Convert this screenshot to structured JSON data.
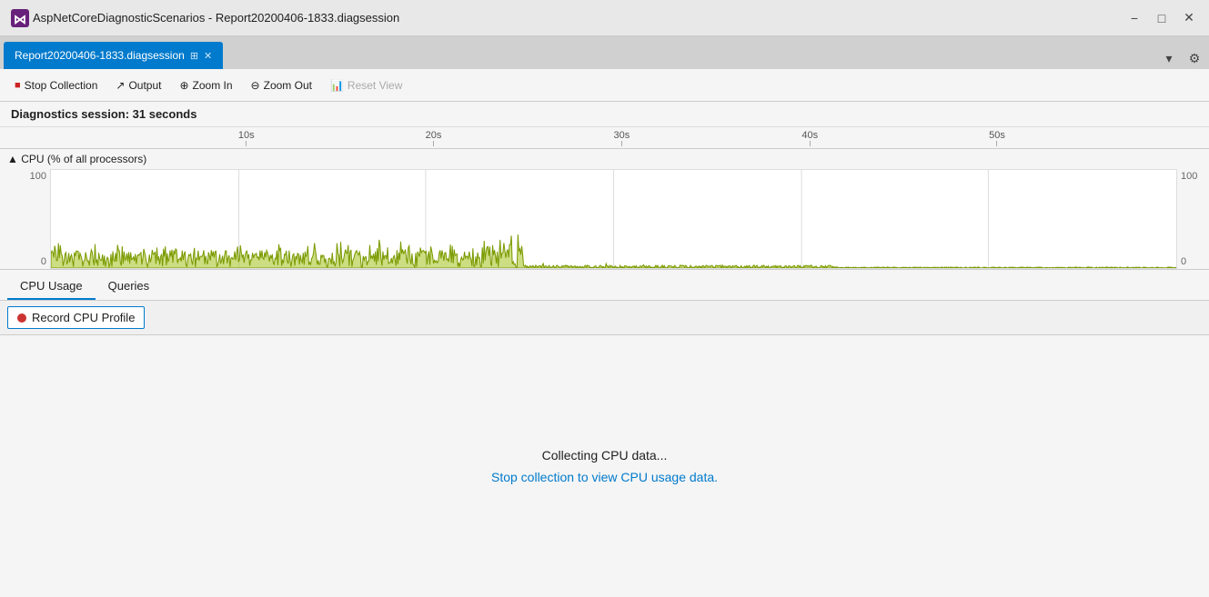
{
  "titleBar": {
    "title": "AspNetCoreDiagnosticScenarios - Report20200406-1833.diagsession",
    "minBtn": "−",
    "maxBtn": "□",
    "closeBtn": "✕"
  },
  "tab": {
    "label": "Report20200406-1833.diagsession",
    "pin": "⊞",
    "close": "✕"
  },
  "toolbar": {
    "stopCollection": "Stop Collection",
    "output": "Output",
    "zoomIn": "Zoom In",
    "zoomOut": "Zoom Out",
    "resetView": "Reset View"
  },
  "diagHeader": {
    "text": "Diagnostics session: 31 seconds"
  },
  "timeRuler": {
    "ticks": [
      {
        "label": "10s",
        "percent": 16.7
      },
      {
        "label": "20s",
        "percent": 33.3
      },
      {
        "label": "30s",
        "percent": 50.0
      },
      {
        "label": "40s",
        "percent": 66.7
      },
      {
        "label": "50s",
        "percent": 83.3
      }
    ]
  },
  "chart": {
    "title": "▲ CPU (% of all processors)",
    "yMax": "100",
    "yMin": "0",
    "yMaxRight": "100",
    "yMinRight": "0"
  },
  "panelTabs": [
    {
      "label": "CPU Usage",
      "active": true
    },
    {
      "label": "Queries",
      "active": false
    }
  ],
  "recordBtn": {
    "label": "Record CPU Profile"
  },
  "status": {
    "collecting": "Collecting CPU data...",
    "stopLink": "Stop collection to view CPU usage data."
  }
}
